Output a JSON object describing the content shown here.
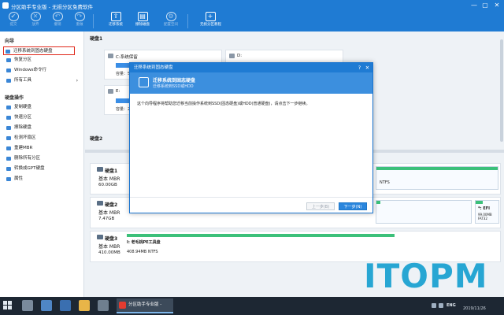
{
  "window": {
    "title": "分区助手专业版 - 无损分区免费软件",
    "min": "—",
    "max": "▢",
    "close": "✕"
  },
  "toolbar": {
    "items": [
      {
        "label": "提交",
        "icon": "✔",
        "state": "dis"
      },
      {
        "label": "放弃",
        "icon": "✕",
        "state": "dis"
      },
      {
        "label": "撤销",
        "icon": "↶",
        "state": "dis"
      },
      {
        "label": "重做",
        "icon": "↷",
        "state": "dis"
      },
      {
        "label": "迁移系统",
        "icon": "⇪",
        "state": "on"
      },
      {
        "label": "擦除磁盘",
        "icon": "▤",
        "state": "on"
      },
      {
        "label": "配置空间",
        "icon": "⚙",
        "state": "dis"
      },
      {
        "label": "无损分区教程",
        "icon": "+",
        "state": "on"
      }
    ]
  },
  "sidebar": {
    "wizard_title": "向导",
    "wizard_items": [
      "迁移系统到固态硬盘",
      "恢复分区",
      "Windows命令行",
      "所有工具"
    ],
    "disk_ops_title": "硬盘操作",
    "disk_items": [
      "复制硬盘",
      "快速分区",
      "擦除硬盘",
      "检测坏扇区",
      "重建MBR",
      "删除所有分区",
      "转换成GPT硬盘",
      "属性"
    ]
  },
  "main": {
    "disk1_label": "硬盘1",
    "disk2_label": "硬盘2",
    "c_name": "C:系统保留",
    "c_capacity": "容量：579.0",
    "d_name": "D:",
    "e_name": "E:",
    "e_capacity": "容量：23.7"
  },
  "disks": [
    {
      "name": "硬盘1",
      "type": "基本 MBR",
      "size": "60.00GB",
      "seg_label": "",
      "seg_value": "",
      "right_label": "",
      "right_value": "",
      "tail_value": "NTFS"
    },
    {
      "name": "硬盘2",
      "type": "基本 MBR",
      "size": "7.47GB",
      "right_label": "*: EFI",
      "right_value": "99.00MB FAT32"
    },
    {
      "name": "硬盘3",
      "type": "基本 MBR",
      "size": "410.00MB",
      "seg_label": "I: 老毛桃PE工具盘",
      "seg_value": "408.94MB NTFS"
    }
  ],
  "dialog": {
    "title": "迁移系统到固态硬盘",
    "help": "?",
    "close": "✕",
    "head_title": "迁移系统到固态硬盘",
    "head_subtitle": "迁移系统到SSD或HDD",
    "body": "这个向导程序将帮助您迁移当前操作系统到SSD(固态硬盘)或HDD(普通硬盘)，请点击下一步继续。",
    "prev": "上一步(B)",
    "next": "下一步(N)"
  },
  "watermark": "ITOPM",
  "taskbar": {
    "app": "分区助手专业版 -",
    "ime": "ENG",
    "date": "2019/11/26"
  },
  "colors": {
    "accent": "#1f7bd3",
    "highlight": "#e0281a",
    "partition_bar": "#3cc07a"
  }
}
